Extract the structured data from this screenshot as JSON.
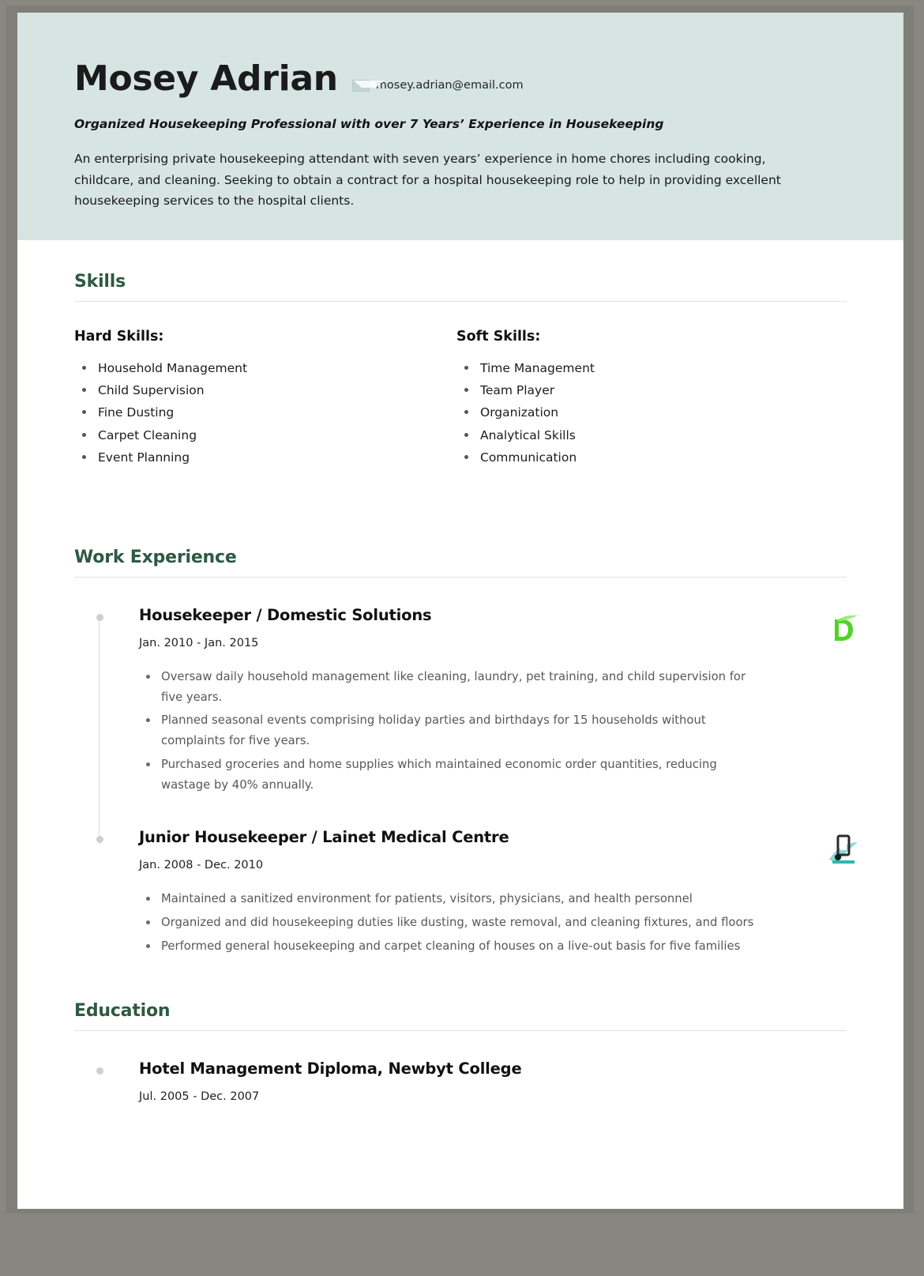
{
  "document_type": "resume",
  "colors": {
    "header_background": "#d6e4e2",
    "section_heading": "#2e5943",
    "page_background": "#ffffff",
    "frame": "#87877f",
    "rule": "#e2e2e2",
    "timeline_dot": "#cfcfcf"
  },
  "header": {
    "name": "Mosey Adrian",
    "email_icon": "envelope-icon",
    "email": "mosey.adrian@email.com",
    "headline": "Organized Housekeeping Professional with over 7 Years’ Experience in Housekeeping",
    "summary": "An enterprising private housekeeping attendant with seven years’ experience in home chores including cooking, childcare, and cleaning. Seeking to obtain a contract for a hospital housekeeping role to help in providing excellent housekeeping services to the hospital clients."
  },
  "skills": {
    "section_title": "Skills",
    "columns": [
      {
        "heading": "Hard Skills:",
        "items": [
          "Household Management",
          "Child Supervision",
          "Fine Dusting",
          "Carpet Cleaning",
          "Event Planning"
        ]
      },
      {
        "heading": "Soft Skills:",
        "items": [
          "Time Management",
          "Team Player",
          "Organization",
          "Analytical Skills",
          "Communication"
        ]
      }
    ]
  },
  "work_experience": {
    "section_title": "Work Experience",
    "entries": [
      {
        "title": "Housekeeper / Domestic Solutions",
        "date": "Jan. 2010 - Jan. 2015",
        "logo": "green-letter-d-logo",
        "duties": [
          "Oversaw daily household management like cleaning, laundry, pet training, and child supervision for five years.",
          "Planned seasonal events comprising holiday parties and birthdays for 15 households without complaints for five years.",
          "Purchased groceries and home supplies which maintained economic order quantities, reducing wastage by 40% annually."
        ]
      },
      {
        "title": "Junior Housekeeper / Lainet Medical Centre",
        "date": "Jan. 2008 - Dec. 2010",
        "logo": "teal-medical-centre-logo",
        "duties": [
          "Maintained a sanitized environment for patients, visitors, physicians, and health personnel",
          "Organized and did housekeeping duties like dusting, waste removal, and cleaning fixtures, and floors",
          "Performed general housekeeping and carpet cleaning of houses on a live-out basis for five families"
        ]
      }
    ]
  },
  "education": {
    "section_title": "Education",
    "entries": [
      {
        "title": "Hotel Management Diploma, Newbyt College",
        "date": "Jul. 2005 - Dec. 2007"
      }
    ]
  }
}
